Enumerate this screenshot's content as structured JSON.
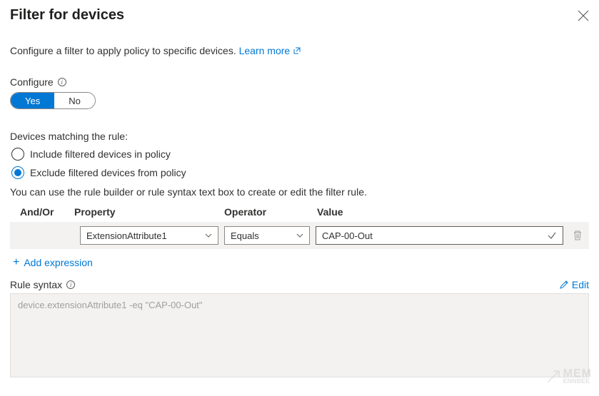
{
  "header": {
    "title": "Filter for devices"
  },
  "intro": {
    "text": "Configure a filter to apply policy to specific devices. ",
    "link": "Learn more"
  },
  "configure": {
    "label": "Configure",
    "yes": "Yes",
    "no": "No"
  },
  "matching": {
    "label": "Devices matching the rule:",
    "include": "Include filtered devices in policy",
    "exclude": "Exclude filtered devices from policy"
  },
  "hint": "You can use the rule builder or rule syntax text box to create or edit the filter rule.",
  "columns": {
    "andor": "And/Or",
    "property": "Property",
    "operator": "Operator",
    "value": "Value"
  },
  "rule": {
    "property": "ExtensionAttribute1",
    "operator": "Equals",
    "value": "CAP-00-Out"
  },
  "add_expression": "Add expression",
  "syntax": {
    "label": "Rule syntax",
    "edit": "Edit",
    "text": "device.extensionAttribute1 -eq \"CAP-00-Out\""
  },
  "watermark": {
    "line1": "MEM",
    "line2": "ENNBEE"
  }
}
